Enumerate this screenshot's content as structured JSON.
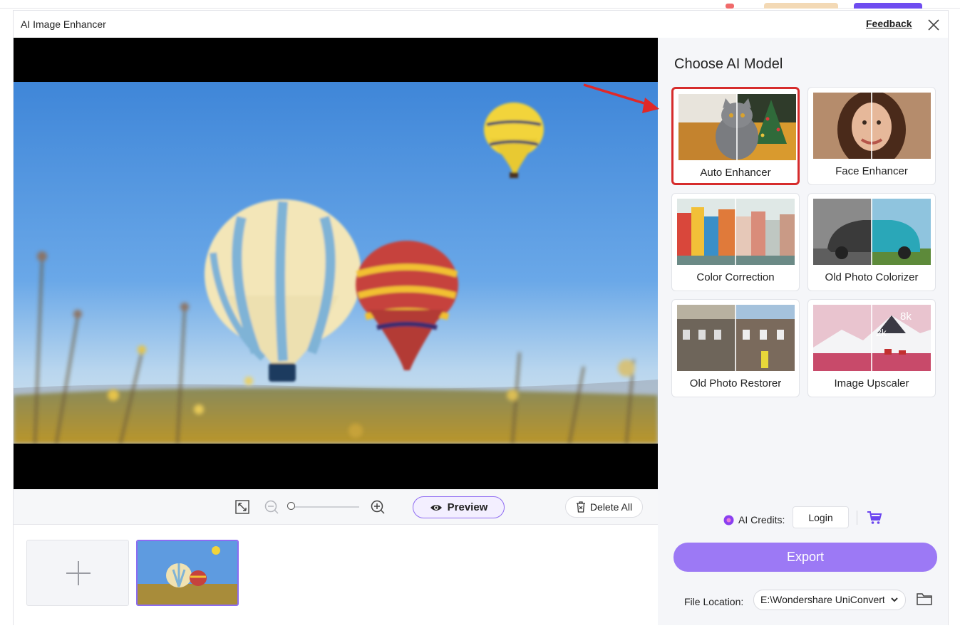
{
  "window": {
    "title": "AI Image Enhancer",
    "feedback_label": "Feedback"
  },
  "toolbar": {
    "preview_label": "Preview",
    "delete_all_label": "Delete All",
    "zoom_level": 0
  },
  "panel": {
    "title": "Choose AI Model",
    "models": [
      {
        "label": "Auto Enhancer",
        "selected": true
      },
      {
        "label": "Face Enhancer",
        "selected": false
      },
      {
        "label": "Color Correction",
        "selected": false
      },
      {
        "label": "Old Photo Colorizer",
        "selected": false
      },
      {
        "label": "Old Photo Restorer",
        "selected": false
      },
      {
        "label": "Image Upscaler",
        "selected": false
      }
    ],
    "upscaler_tags": [
      "8k",
      "2k"
    ]
  },
  "account": {
    "credits_label": "AI Credits:",
    "login_label": "Login"
  },
  "export": {
    "button_label": "Export",
    "file_location_label": "File Location:",
    "file_location_value": "E:\\Wondershare UniConverter"
  },
  "colors": {
    "accent": "#8c6cf2",
    "export_bg": "#9c79f5",
    "selection_border": "#d62c2c",
    "credits_icon": "#8a3ff0",
    "cart_icon": "#6b45f0"
  },
  "icons": [
    "close-icon",
    "fit-screen-icon",
    "zoom-out-icon",
    "zoom-in-icon",
    "eye-icon",
    "trash-icon",
    "add-icon",
    "credits-icon",
    "cart-icon",
    "chevron-down-icon",
    "folder-icon"
  ]
}
